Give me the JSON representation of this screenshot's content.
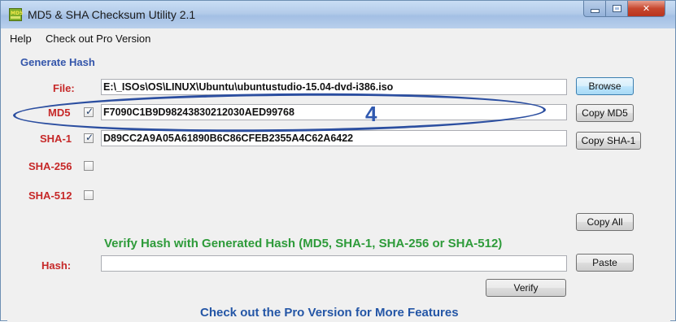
{
  "window": {
    "title": "MD5 & SHA Checksum Utility 2.1",
    "app_icon_text": "MD5"
  },
  "menu": {
    "items": [
      "Help",
      "Check out Pro Version"
    ]
  },
  "generate": {
    "section_title": "Generate Hash",
    "file_label": "File:",
    "file_path": "E:\\_ISOs\\OS\\LINUX\\Ubuntu\\ubuntustudio-15.04-dvd-i386.iso",
    "browse_label": "Browse",
    "md5": {
      "label": "MD5",
      "checked": true,
      "value": "F7090C1B9D98243830212030AED99768",
      "copy_label": "Copy MD5"
    },
    "sha1": {
      "label": "SHA-1",
      "checked": true,
      "value": "D89CC2A9A05A61890B6C86CFEB2355A4C62A6422",
      "copy_label": "Copy SHA-1"
    },
    "sha256": {
      "label": "SHA-256",
      "checked": false,
      "value": ""
    },
    "sha512": {
      "label": "SHA-512",
      "checked": false,
      "value": ""
    },
    "copy_all_label": "Copy All"
  },
  "verify": {
    "heading": "Verify Hash with Generated Hash (MD5, SHA-1, SHA-256 or SHA-512)",
    "hash_label": "Hash:",
    "hash_value": "",
    "paste_label": "Paste",
    "verify_label": "Verify"
  },
  "footer": {
    "text": "Check out the Pro Version for More Features"
  },
  "annotation": {
    "number": "4"
  },
  "colors": {
    "label_red": "#c62828",
    "heading_blue": "#3355aa",
    "verify_green": "#2e9b3a",
    "annotation_blue": "#2b4ea0"
  }
}
